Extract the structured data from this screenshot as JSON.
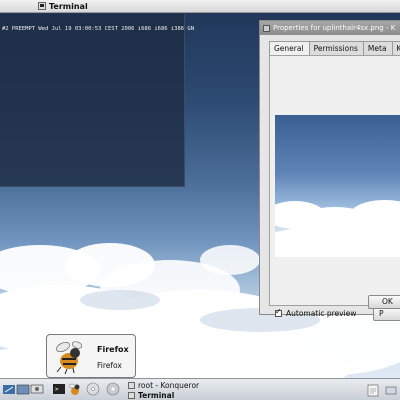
{
  "top_window": {
    "title": "Terminal"
  },
  "terminal": {
    "line": "#2 PREEMPT Wed Jul 19 03:00:53 CEST 2006 i686 i686 i386 GN"
  },
  "dialog": {
    "title": "Properties for uplinthair4sx.png - K",
    "tabs": [
      {
        "label": "General"
      },
      {
        "label": "Permissions"
      },
      {
        "label": "Meta Info"
      },
      {
        "label": "K"
      }
    ],
    "auto_preview_label": "Automatic preview",
    "preview_button": "P",
    "ok_button": "OK"
  },
  "tooltip": {
    "title": "Firefox",
    "subtitle": "Firefox"
  },
  "taskbar": {
    "tasks": [
      {
        "label": "root - Konqueror",
        "active": false
      },
      {
        "label": "Terminal",
        "active": true
      }
    ]
  },
  "colors": {
    "dialog_titlebar": "#9a9a9a",
    "terminal_bg": "#1e2d46"
  }
}
